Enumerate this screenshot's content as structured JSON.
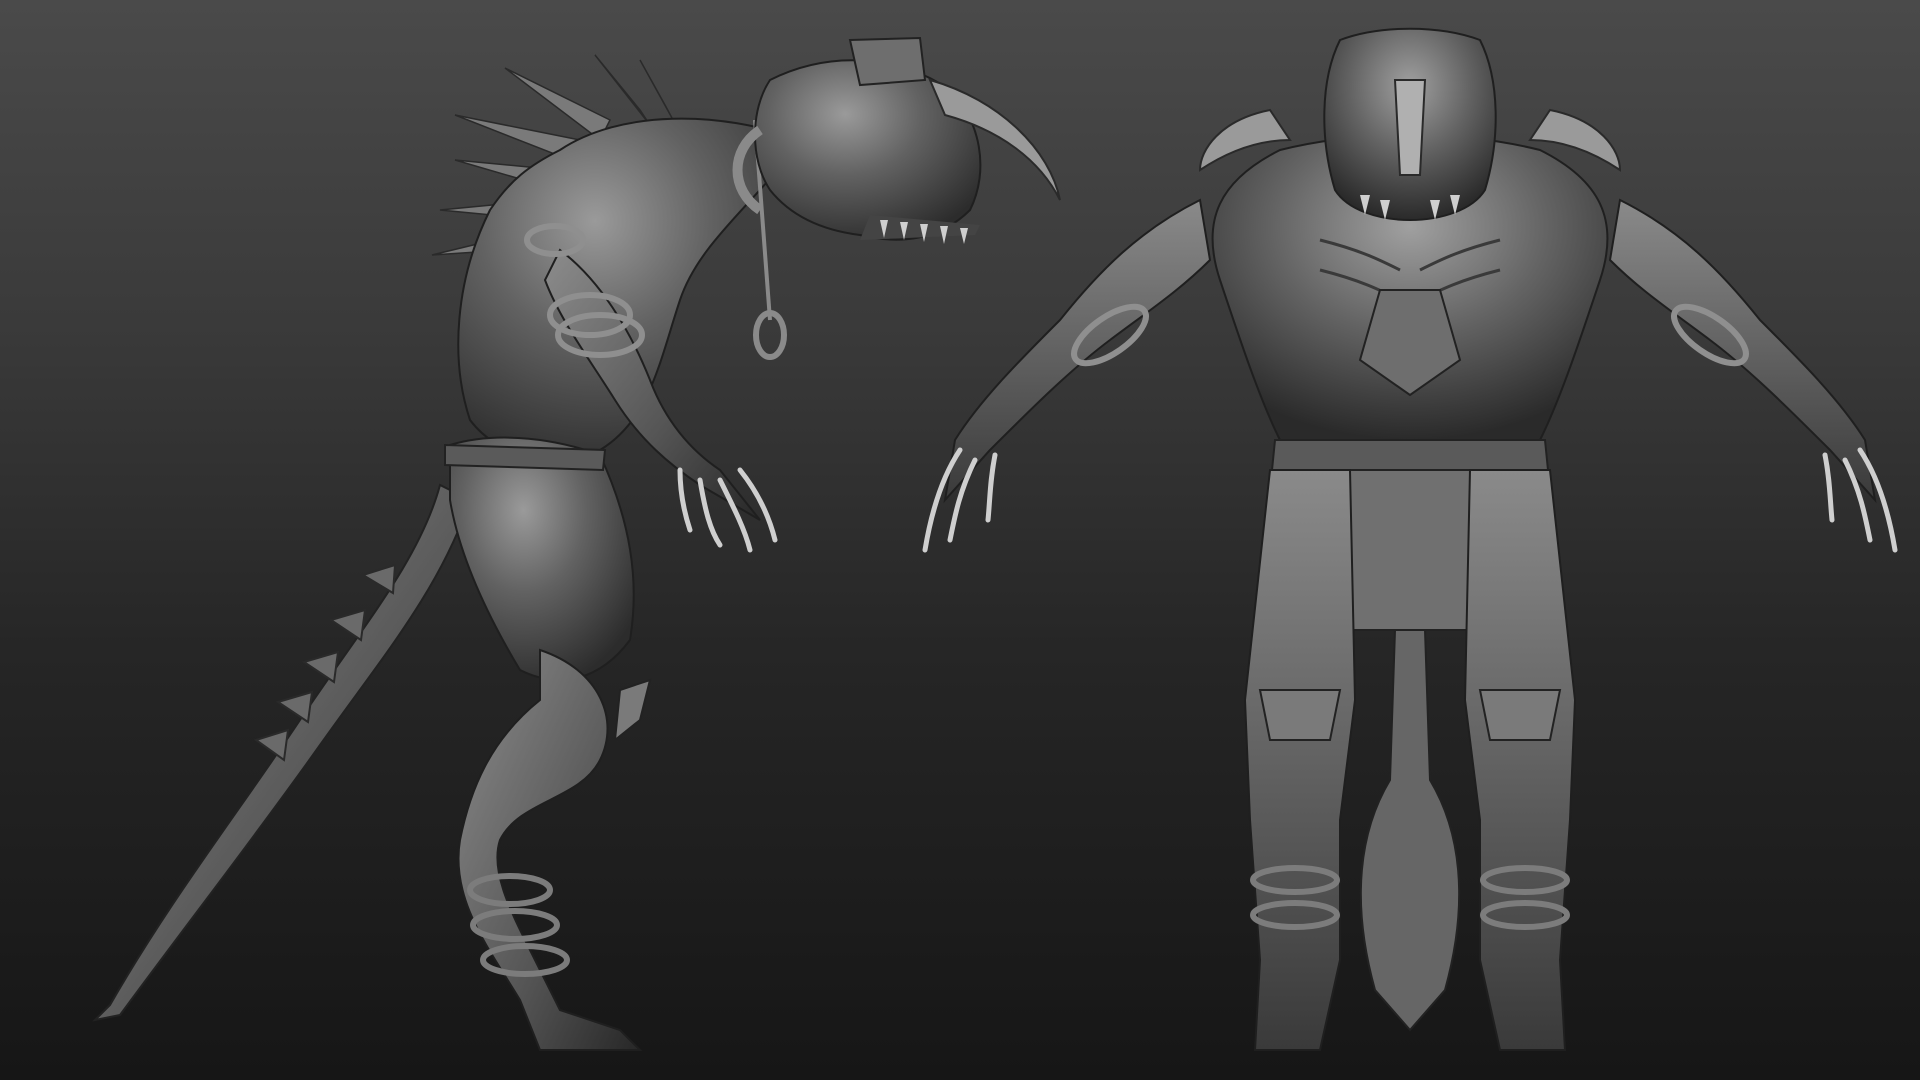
{
  "scene": {
    "description_kind": "zbrush-style clay sculpt turnaround",
    "views": [
      {
        "id": "side",
        "label": ""
      },
      {
        "id": "front",
        "label": ""
      }
    ]
  },
  "colors": {
    "background_top": "#4a4a4a",
    "background_bottom": "#161616",
    "clay_light": "#8a8a8a",
    "clay_mid": "#5e5e5e",
    "clay_dark": "#333333",
    "clay_shadow": "#1e1e1e"
  }
}
